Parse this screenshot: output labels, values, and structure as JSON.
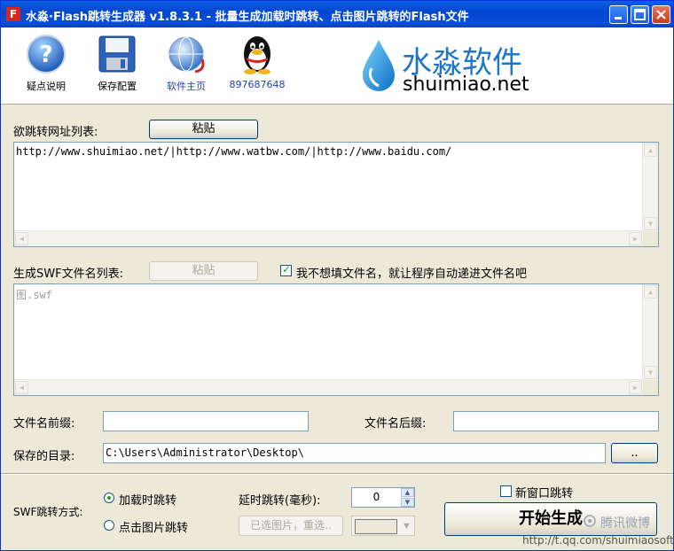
{
  "window": {
    "title": "水淼·Flash跳转生成器 v1.8.3.1 - 批量生成加载时跳转、点击图片跳转的Flash文件",
    "app_icon_letter": "F"
  },
  "toolbar": {
    "items": [
      {
        "label": "疑点说明",
        "icon": "help-icon"
      },
      {
        "label": "保存配置",
        "icon": "floppy-disk-icon"
      },
      {
        "label": "软件主页",
        "icon": "globe-icon",
        "color": "#1f3fb5"
      },
      {
        "label": "897687648",
        "icon": "qq-penguin-icon",
        "color": "#1f3fb5"
      }
    ],
    "logo_cn": "水淼软件",
    "logo_en": "shuimiao.net"
  },
  "url_list": {
    "label": "欲跳转网址列表:",
    "paste_label": "粘贴",
    "value": "http://www.shuimiao.net/|http://www.watbw.com/|http://www.baidu.com/"
  },
  "swf_list": {
    "label": "生成SWF文件名列表:",
    "paste_label": "粘贴",
    "auto_name_label": "我不想填文件名，就让程序自动递进文件名吧",
    "auto_name_checked": true,
    "value": "图.swf"
  },
  "prefix": {
    "label": "文件名前缀:",
    "value": ""
  },
  "suffix": {
    "label": "文件名后缀:",
    "value": ""
  },
  "save_dir": {
    "label": "保存的目录:",
    "value": "C:\\Users\\Administrator\\Desktop\\",
    "browse_label": ".."
  },
  "jump_mode": {
    "label": "SWF跳转方式:",
    "options": [
      "加载时跳转",
      "点击图片跳转"
    ],
    "selected": "加载时跳转"
  },
  "delay": {
    "label": "延时跳转(毫秒):",
    "value": "0"
  },
  "select_image": {
    "label": "已选图片，重选.."
  },
  "new_window": {
    "label": "新窗口跳转",
    "checked": false
  },
  "start": {
    "label": "开始生成"
  },
  "watermark": {
    "brand": "腾讯微博",
    "url": "http://t.qq.com/shuimiaosoft"
  }
}
